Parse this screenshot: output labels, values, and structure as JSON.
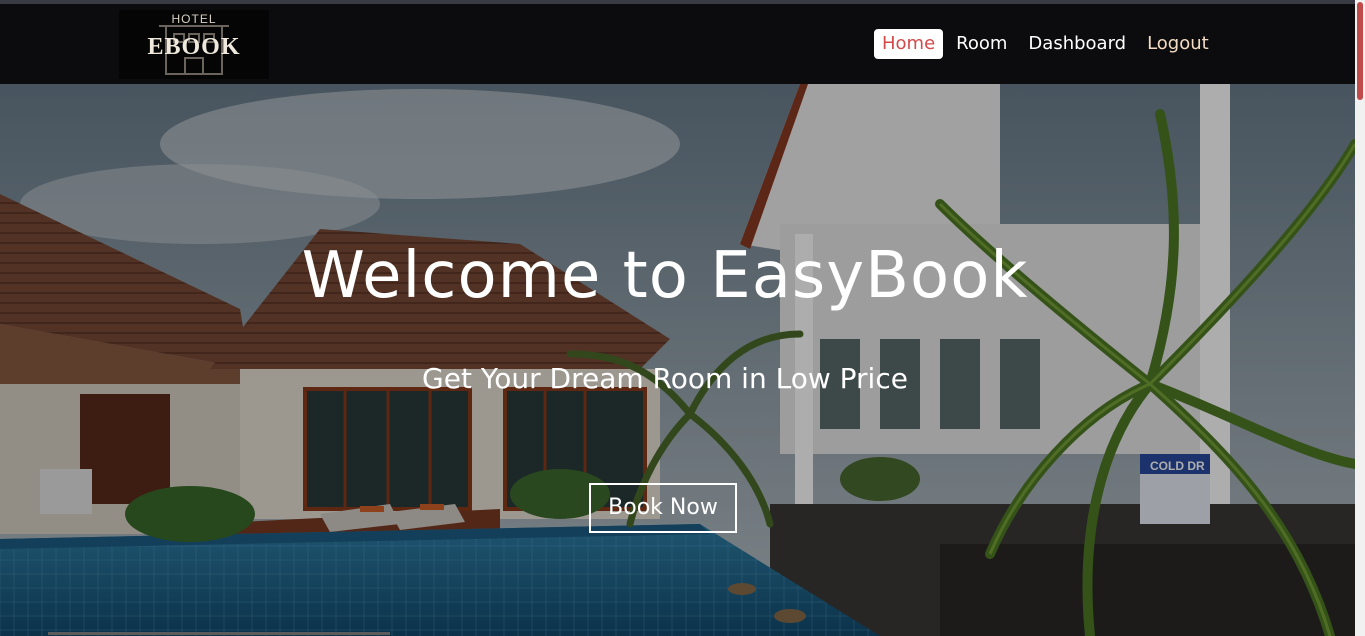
{
  "logo": {
    "small_text": "HOTEL",
    "big_text": "EBOOK"
  },
  "nav": {
    "items": [
      {
        "label": "Home",
        "active": true
      },
      {
        "label": "Room",
        "active": false
      },
      {
        "label": "Dashboard",
        "active": false
      },
      {
        "label": "Logout",
        "active": false
      }
    ]
  },
  "hero": {
    "title": "Welcome to EasyBook",
    "subtitle": "Get Your Dream Room in Low Price",
    "cta_label": "Book Now",
    "sign_text": "COLD DR"
  },
  "colors": {
    "nav_bg": "#0c0c0e",
    "active_text": "#d24a4a",
    "scroll_thumb": "#c14a4a",
    "logout_text": "#f3dcc3"
  }
}
